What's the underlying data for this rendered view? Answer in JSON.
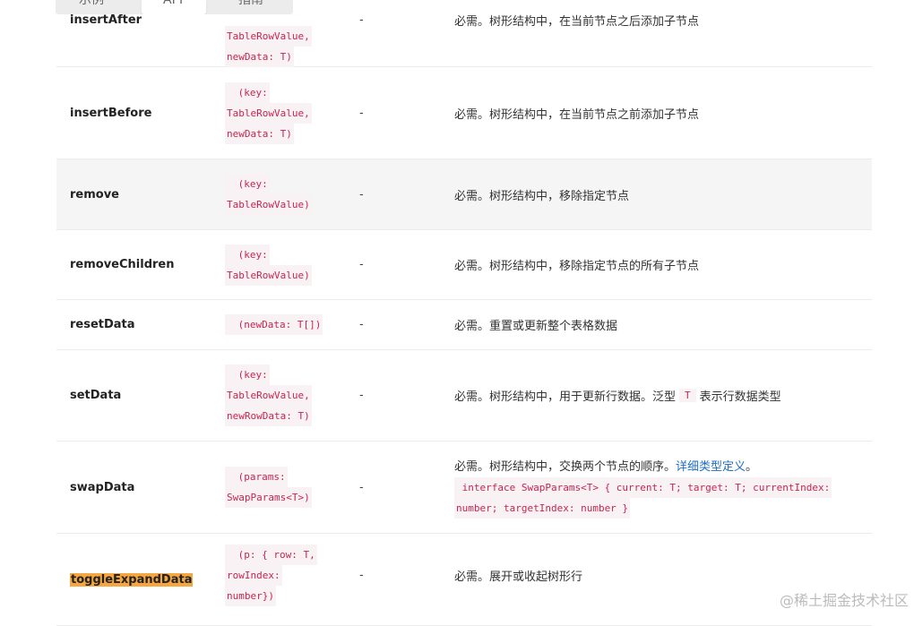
{
  "tabs": [
    {
      "label": "示例"
    },
    {
      "label": "API"
    },
    {
      "label": "指南"
    }
  ],
  "rows": [
    {
      "name": "insertAfter",
      "type": [
        "TableRowValue,",
        "newData: T)"
      ],
      "default": "-",
      "desc": "必需。树形结构中，在当前节点之后添加子节点"
    },
    {
      "name": "insertBefore",
      "type": [
        " (key:",
        "TableRowValue,",
        "newData: T)"
      ],
      "default": "-",
      "desc": "必需。树形结构中，在当前节点之前添加子节点"
    },
    {
      "name": "remove",
      "type": [
        " (key:",
        "TableRowValue)"
      ],
      "default": "-",
      "desc": "必需。树形结构中，移除指定节点"
    },
    {
      "name": "removeChildren",
      "type": [
        " (key:",
        "TableRowValue)"
      ],
      "default": "-",
      "desc": "必需。树形结构中，移除指定节点的所有子节点"
    },
    {
      "name": "resetData",
      "type": [
        " (newData: T[])"
      ],
      "default": "-",
      "desc": "必需。重置或更新整个表格数据"
    },
    {
      "name": "setData",
      "type": [
        " (key:",
        "TableRowValue,",
        "newRowData: T)"
      ],
      "default": "-",
      "desc_prefix": "必需。树形结构中，用于更新行数据。泛型",
      "desc_code": "T",
      "desc_suffix": "表示行数据类型"
    },
    {
      "name": "swapData",
      "type": [
        " (params:",
        "SwapParams<T>)"
      ],
      "default": "-",
      "desc_text": "必需。树形结构中，交换两个节点的顺序。",
      "desc_link": "详细类型定义",
      "desc_end": "。",
      "desc_code1": " interface SwapParams<T> { current: T; target: T; currentIndex:",
      "desc_code2": "number; targetIndex: number }"
    },
    {
      "name": "toggleExpandData",
      "type": [
        " (p: { row: T,",
        "rowIndex:",
        "number})"
      ],
      "default": "-",
      "desc": "必需。展开或收起树形行"
    }
  ],
  "watermark": "@稀土掘金技术社区"
}
